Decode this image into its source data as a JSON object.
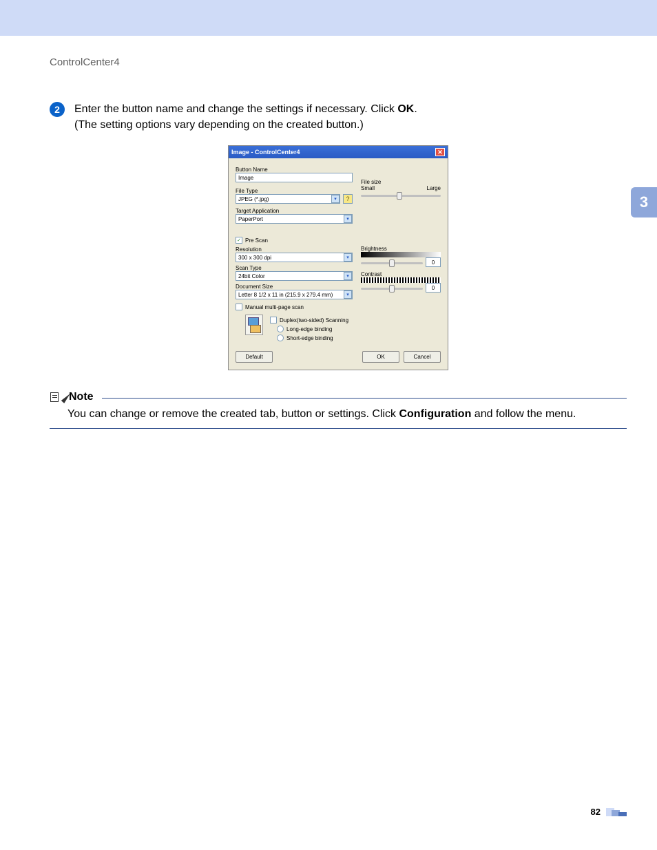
{
  "breadcrumb": "ControlCenter4",
  "side_tab": "3",
  "page_number": "82",
  "step": {
    "number": "2",
    "line1_a": "Enter the button name and change the settings if necessary. Click ",
    "line1_b": "OK",
    "line1_c": ".",
    "line2": "(The setting options vary depending on the created button.)"
  },
  "dialog": {
    "title": "Image - ControlCenter4",
    "close": "✕",
    "labels": {
      "button_name": "Button Name",
      "file_type": "File Type",
      "target_app": "Target Application",
      "file_size": "File size",
      "small": "Small",
      "large": "Large",
      "brightness": "Brightness",
      "contrast": "Contrast",
      "prescan": "Pre Scan",
      "resolution": "Resolution",
      "scan_type": "Scan Type",
      "document_size": "Document Size",
      "manual_multi": "Manual multi-page scan",
      "duplex": "Duplex(two-sided) Scanning",
      "long_edge": "Long-edge binding",
      "short_edge": "Short-edge binding"
    },
    "values": {
      "button_name": "Image",
      "file_type": "JPEG (*.jpg)",
      "target_app": "PaperPort",
      "resolution": "300 x 300 dpi",
      "scan_type": "24bit Color",
      "document_size": "Letter 8 1/2 x 11 in (215.9 x 279.4 mm)",
      "brightness_val": "0",
      "contrast_val": "0"
    },
    "buttons": {
      "default": "Default",
      "ok": "OK",
      "cancel": "Cancel"
    }
  },
  "note": {
    "title": "Note",
    "body_a": "You can change or remove the created tab, button or settings. Click ",
    "body_b": "Configuration",
    "body_c": " and follow the menu."
  }
}
